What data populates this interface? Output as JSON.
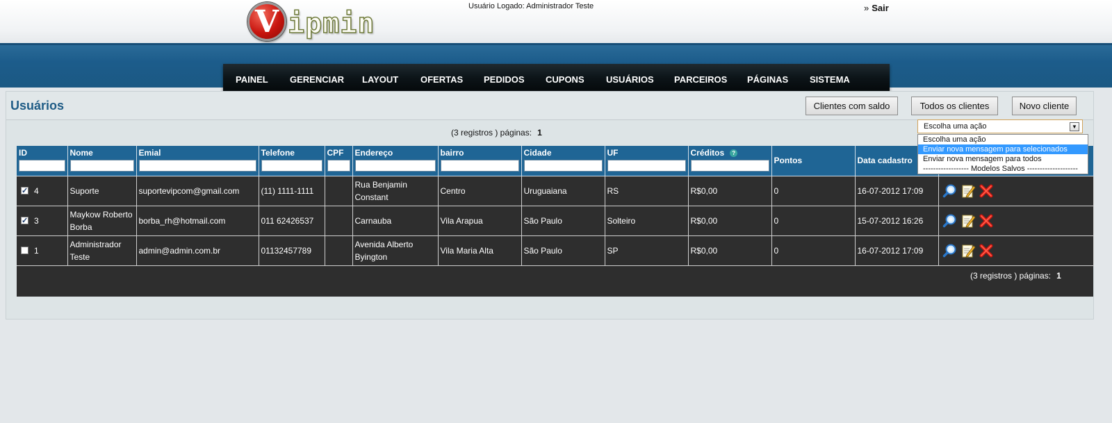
{
  "header": {
    "logo_letter": "V",
    "logo_text": "ipmin",
    "user_logged": "Usuário Logado: Administrador Teste",
    "logout_bullet": "»",
    "logout_label": "Sair"
  },
  "nav": {
    "items": [
      "PAINEL",
      "GERENCIAR",
      "LAYOUT",
      "OFERTAS",
      "PEDIDOS",
      "CUPONS",
      "USUÁRIOS",
      "PARCEIROS",
      "PÁGINAS",
      "SISTEMA"
    ]
  },
  "page": {
    "title": "Usuários",
    "buttons": {
      "clients_with_balance": "Clientes com saldo",
      "all_clients": "Todos os clientes",
      "new_client": "Novo cliente"
    },
    "pager": {
      "text": "(3 registros ) páginas:",
      "page": "1"
    }
  },
  "action_select": {
    "selected": "Escolha uma ação",
    "options": [
      "Escolha uma ação",
      "Enviar nova mensagem para selecionados",
      "Enviar nova mensagem para todos",
      "------------------ Modelos Salvos --------------------"
    ],
    "highlighted_index": 1
  },
  "table": {
    "columns": [
      "ID",
      "Nome",
      "Emial",
      "Telefone",
      "CPF",
      "Endereço",
      "bairro",
      "Cidade",
      "UF",
      "Créditos",
      "Pontos",
      "Data cadastro"
    ],
    "credits_help": "?",
    "rows": [
      {
        "checked": true,
        "id": "4",
        "nome": "Suporte",
        "email": "suportevipcom@gmail.com",
        "telefone": "(11) 1111-1111",
        "cpf": "",
        "endereco": "Rua Benjamin Constant",
        "bairro": "Centro",
        "cidade": "Uruguaiana",
        "uf": "RS",
        "creditos": "R$0,00",
        "pontos": "0",
        "data": "16-07-2012 17:09"
      },
      {
        "checked": true,
        "id": "3",
        "nome": "Maykow Roberto Borba",
        "email": "borba_rh@hotmail.com",
        "telefone": "011 62426537",
        "cpf": "",
        "endereco": "Carnauba",
        "bairro": "Vila Arapua",
        "cidade": "São Paulo",
        "uf": "Solteiro",
        "creditos": "R$0,00",
        "pontos": "0",
        "data": "15-07-2012 16:26"
      },
      {
        "checked": false,
        "id": "1",
        "nome": "Administrador Teste",
        "email": "admin@admin.com.br",
        "telefone": "01132457789",
        "cpf": "",
        "endereco": "Avenida Alberto Byington",
        "bairro": "Vila Maria Alta",
        "cidade": "São Paulo",
        "uf": "SP",
        "creditos": "R$0,00",
        "pontos": "0",
        "data": "16-07-2012 17:09"
      }
    ]
  },
  "icons": {
    "view": "magnifier-icon",
    "edit": "edit-icon",
    "delete": "delete-icon"
  }
}
